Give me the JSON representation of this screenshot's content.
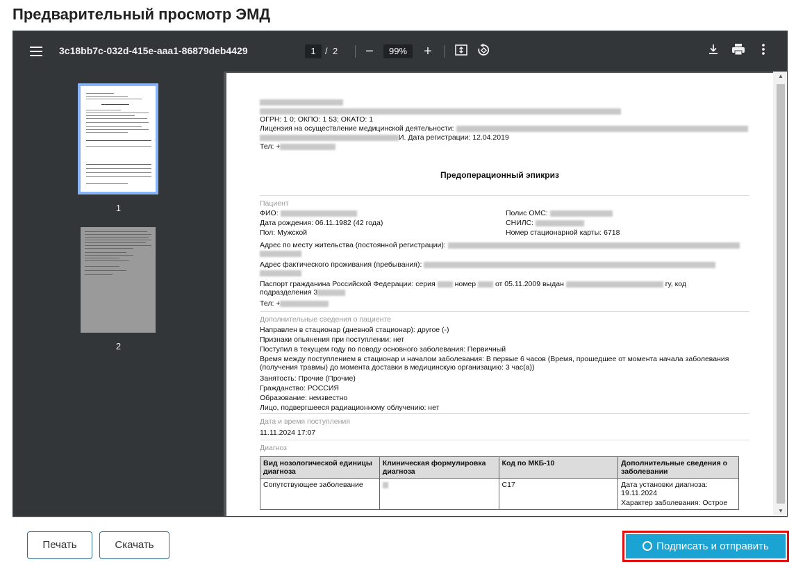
{
  "page_title": "Предварительный просмотр ЭМД",
  "viewer": {
    "doc_id": "3c18bb7c-032d-415e-aaa1-86879deb4429",
    "current_page": "1",
    "page_sep": "/",
    "total_pages": "2",
    "zoom": "99%",
    "zoom_out": "−",
    "zoom_in": "+",
    "thumbnails": [
      "1",
      "2"
    ]
  },
  "document": {
    "ogrn_line": "ОГРН: 1          0; ОКПО: 1      53; ОКАТО: 1",
    "license_line": "Лицензия на осуществление медицинской деятельности:",
    "license_date": "И. Дата регистрации: 12.04.2019",
    "tel_org": "Тел: +",
    "heading": "Предоперационный эпикриз",
    "patient_section": "Пациент",
    "fio": "ФИО:",
    "dob": "Дата рождения: 06.11.1982 (42 года)",
    "sex": "Пол: Мужской",
    "polis": "Полис ОМС:",
    "snils": "СНИЛС:",
    "card_no": "Номер стационарной карты: 6718",
    "addr_reg": "Адрес по месту жительства (постоянной регистрации):",
    "addr_fact": "Адрес фактического проживания (пребывания):",
    "passport": "Паспорт гражданина Российской Федерации: серия",
    "passport_num": "номер",
    "passport_issued": "от 05.11.2009 выдан",
    "passport_code": "гу, код",
    "passport_line2": "подразделения 3",
    "tel_patient": "Тел: +",
    "extra_section": "Дополнительные сведения о пациенте",
    "extra_lines": [
      "Направлен в стационар (дневной стационар): другое (-)",
      "Признаки опьянения при поступлении: нет",
      "Поступил в текущем году по поводу основного заболевания: Первичный",
      "Время между поступлением в стационар и началом заболевания: В первые 6 часов (Время, прошедшее от момента начала заболевания",
      "(получения травмы) до момента доставки в медицинскую организацию: 3 час(а))",
      "Занятость: Прочие (Прочие)",
      "Гражданство: РОССИЯ",
      "Образование: неизвестно",
      "Лицо, подвергшееся радиационному облучению: нет"
    ],
    "admission_section": "Дата и время поступления",
    "admission_value": "11.11.2024 17:07",
    "diagnosis_section": "Диагноз",
    "table_headers": [
      "Вид нозологической единицы диагноза",
      "Клиническая формулировка диагноза",
      "Код по МКБ-10",
      "Дополнительные сведения о заболевании"
    ],
    "table_row": {
      "type": "Сопутствующее заболевание",
      "code": "C17",
      "extra_1": "Дата установки диагноза: 19.11.2024",
      "extra_2": "Характер заболевания: Острое"
    }
  },
  "footer": {
    "print_label": "Печать",
    "download_label": "Скачать",
    "sign_label": "Подписать и отправить"
  },
  "colors": {
    "accent": "#1ba3d3",
    "highlight": "#e01010",
    "toolbar": "#323639"
  }
}
